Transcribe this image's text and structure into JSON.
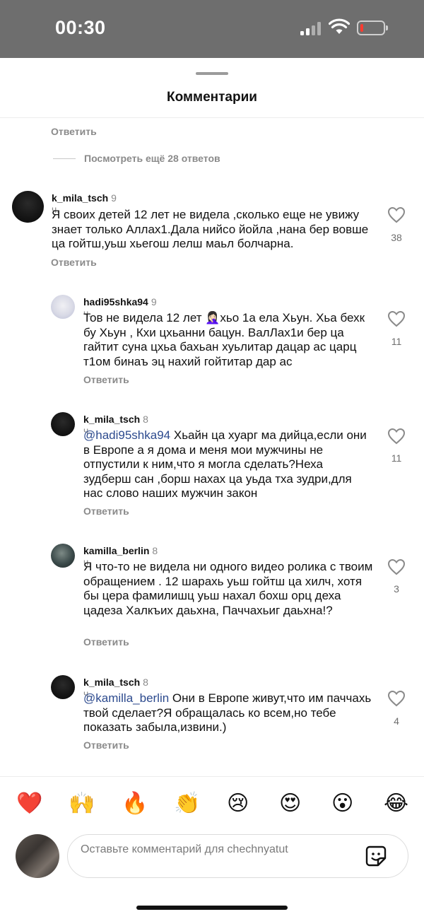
{
  "status": {
    "time": "00:30"
  },
  "sheet": {
    "title": "Комментарии",
    "top_reply_label": "Ответить",
    "more_replies": "Посмотреть ещё 28 ответов"
  },
  "comments": [
    {
      "user": "k_mila_tsch",
      "time": "9 ч.",
      "mention": "",
      "text": "Я своих детей 12 лет не видела ,сколько еще не увижу знает только Аллах1.Дала нийсо йойла ,нана бер вовше ца гойтш,уьш хьегош лелш маьл болчарна.",
      "likes": "38",
      "reply": "Ответить"
    },
    {
      "user": "hadi95shka94",
      "time": "9 ч.",
      "mention": "",
      "text_before_emoji": "Тов не видела 12 лет ",
      "emoji": "🤦🏻‍♀️",
      "text": "хьо 1а ела Хьун. Хьа бехк бу Хьун , Кхи цхьанни бацун. ВалЛах1и бер ца гайтит суна цхьа бахьан хуьлитар дацар ас царц т1ом бинаъ эц нахий гойтитар дар ас",
      "likes": "11",
      "reply": "Ответить"
    },
    {
      "user": "k_mila_tsch",
      "time": "8 ч.",
      "mention": "@hadi95shka94",
      "text": " Хьайн ца хуарг ма дийца,если они в Европе а я дома и меня мои мужчины не отпустили к ним,что я могла сделать?Неха зудберш сан ,борш нахах ца уьда тха зудри,для нас слово наших мужчин закон",
      "likes": "11",
      "reply": "Ответить"
    },
    {
      "user": "kamilla_berlin",
      "time": "8 ч.",
      "mention": "",
      "text": "Я что-то не видела ни одного видео ролика с твоим обращением . 12 шарахь уьш гойтш ца хилч, хотя бы цера фамилишц уьш нахал бохш орц деха цадеза Халкъих даьхна, Паччахьиг даьхна!?",
      "likes": "3",
      "reply": "Ответить"
    },
    {
      "user": "k_mila_tsch",
      "time": "8 ч.",
      "mention": "@kamilla_berlin",
      "text": " Они в Европе живут,что им паччахь твой сделает?Я обращалась ко всем,но тебе показать забыла,извини.)",
      "likes": "4",
      "reply": "Ответить"
    }
  ],
  "reactions": [
    "❤️",
    "🙌",
    "🔥",
    "👏",
    "😢",
    "😍",
    "😮",
    "😂"
  ],
  "composer": {
    "placeholder": "Оставьте комментарий для chechnyatut"
  }
}
